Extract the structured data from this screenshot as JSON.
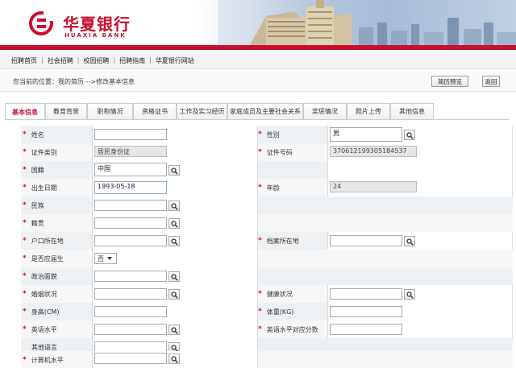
{
  "brand": {
    "name_cn": "华夏银行",
    "name_en": "HUAXIA BANK",
    "color": "#c8102e"
  },
  "topnav": [
    "招聘首页",
    "社会招聘",
    "校园招聘",
    "招聘指南",
    "华夏银行网站"
  ],
  "topnav_sep": "|",
  "breadcrumb": "您当前的位置：我的简历 -->修改基本信息",
  "buttons": {
    "preview": "简历预览",
    "back": "返回"
  },
  "tabs": [
    "基本信息",
    "教育背景",
    "职称情况",
    "资格证书",
    "工作及实习经历",
    "家庭成员及主要社会关系",
    "奖惩情况",
    "照片上传",
    "其他信息"
  ],
  "form": {
    "name": {
      "label": "姓名",
      "value": ""
    },
    "gender": {
      "label": "性别",
      "value": "男"
    },
    "id_type": {
      "label": "证件类别",
      "value": "居民身份证"
    },
    "id_number": {
      "label": "证件号码",
      "value": "370612199305184537"
    },
    "nationality": {
      "label": "国籍",
      "value": "中国"
    },
    "birth_date": {
      "label": "出生日期",
      "value": "1993-05-18"
    },
    "age": {
      "label": "年龄",
      "value": "24"
    },
    "ethnicity": {
      "label": "民族",
      "value": ""
    },
    "native_place": {
      "label": "籍贯",
      "value": ""
    },
    "hukou": {
      "label": "户口所在地",
      "value": ""
    },
    "archive": {
      "label": "档案所在地",
      "value": ""
    },
    "fresh_grad": {
      "label": "是否应届生",
      "value": "否"
    },
    "political": {
      "label": "政治面貌",
      "value": ""
    },
    "marital": {
      "label": "婚姻状况",
      "value": ""
    },
    "health": {
      "label": "健康状况",
      "value": ""
    },
    "height": {
      "label": "身高(CM)",
      "value": ""
    },
    "weight": {
      "label": "体重(KG)",
      "value": ""
    },
    "english": {
      "label": "英语水平",
      "value": ""
    },
    "english_score": {
      "label": "英语水平对应分数",
      "value": ""
    },
    "other_lang": {
      "label": "其他语言",
      "value": ""
    },
    "computer": {
      "label": "计算机水平",
      "value": ""
    }
  },
  "required_mark": "*"
}
